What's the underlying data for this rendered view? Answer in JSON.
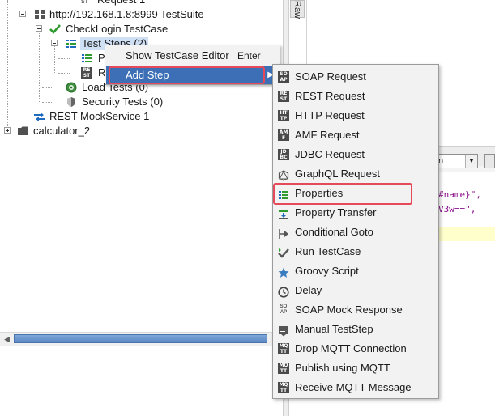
{
  "tree": {
    "request1": "Request 1",
    "testsuite": "http://192.168.1.8:8999 TestSuite",
    "testcase": "CheckLogin TestCase",
    "teststeps": "Test Steps (2)",
    "step1_initial": "P",
    "step2_initial": "R",
    "load_tests": "Load Tests (0)",
    "security_tests": "Security Tests (0)",
    "mockservice": "REST MockService 1",
    "calculator": "calculator_2"
  },
  "right_pane": {
    "raw_tab": "Raw",
    "encoding_value": "n",
    "code_line1": "#name}\",",
    "code_line2": "V3w==\","
  },
  "context_menu": {
    "items": [
      {
        "label": "Show TestCase Editor",
        "accelerator": "Enter"
      },
      {
        "label": "Add Step",
        "accelerator": "",
        "submenu_glyph": "▶"
      }
    ]
  },
  "add_step_submenu": {
    "items": [
      {
        "label": "SOAP Request",
        "icon": "soap-request-icon"
      },
      {
        "label": "REST Request",
        "icon": "rest-request-icon"
      },
      {
        "label": "HTTP Request",
        "icon": "http-request-icon"
      },
      {
        "label": "AMF Request",
        "icon": "amf-request-icon"
      },
      {
        "label": "JDBC Request",
        "icon": "jdbc-request-icon"
      },
      {
        "label": "GraphQL Request",
        "icon": "graphql-icon"
      },
      {
        "label": "Properties",
        "icon": "properties-icon"
      },
      {
        "label": "Property Transfer",
        "icon": "property-transfer-icon"
      },
      {
        "label": "Conditional Goto",
        "icon": "conditional-goto-icon"
      },
      {
        "label": "Run TestCase",
        "icon": "run-testcase-icon"
      },
      {
        "label": "Groovy Script",
        "icon": "groovy-star-icon"
      },
      {
        "label": "Delay",
        "icon": "clock-icon"
      },
      {
        "label": "SOAP Mock Response",
        "icon": "soap-mock-icon"
      },
      {
        "label": "Manual TestStep",
        "icon": "manual-step-icon"
      },
      {
        "label": "Drop MQTT Connection",
        "icon": "mqtt-icon"
      },
      {
        "label": "Publish using MQTT",
        "icon": "mqtt-icon"
      },
      {
        "label": "Receive MQTT Message",
        "icon": "mqtt-icon"
      }
    ]
  },
  "colors": {
    "selection": "#3c6fb5",
    "annotation_red": "#e5495a",
    "checkmark_green": "#2e9b2e"
  }
}
